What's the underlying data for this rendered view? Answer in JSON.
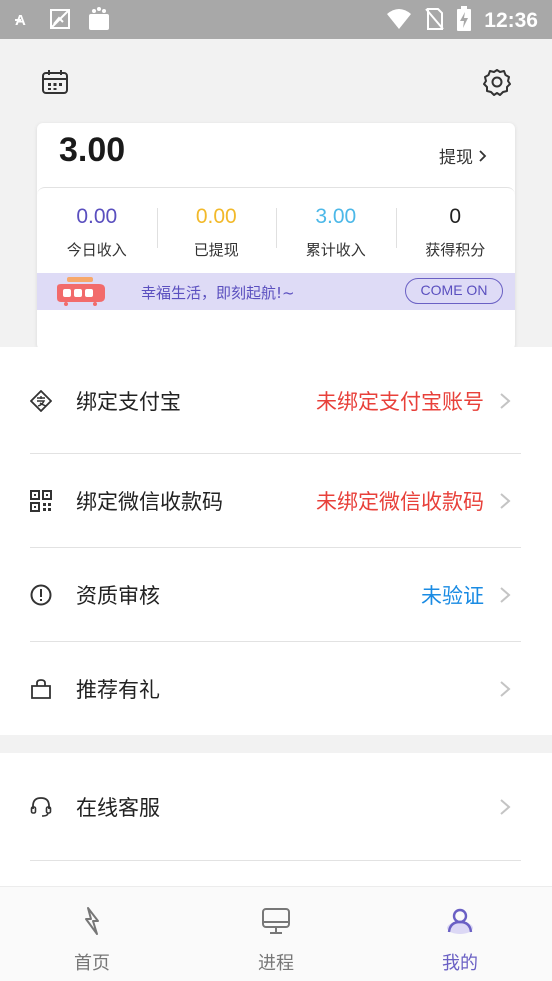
{
  "status_bar": {
    "time": "12:36",
    "icons": [
      "font-a-icon",
      "image-icon",
      "bag-icon",
      "wifi-icon",
      "no-sim-icon",
      "battery-charging-icon"
    ]
  },
  "header": {
    "left_icon": "calendar-icon",
    "right_icon": "settings-icon"
  },
  "card": {
    "balance": "3.00",
    "withdraw_label": "提现",
    "stats": [
      {
        "value": "0.00",
        "label": "今日收入",
        "color": "#5a4fbf"
      },
      {
        "value": "0.00",
        "label": "已提现",
        "color": "#f2b92a"
      },
      {
        "value": "3.00",
        "label": "累计收入",
        "color": "#4cb8e8"
      },
      {
        "value": "0",
        "label": "获得积分",
        "color": "#222222"
      }
    ],
    "banner": {
      "text": "幸福生活，即刻起航!~",
      "button": "COME ON",
      "icon": "rocket-icon"
    }
  },
  "menu": {
    "group1": [
      {
        "icon": "alipay-icon",
        "label": "绑定支付宝",
        "status": "未绑定支付宝账号",
        "status_color": "#e8403a"
      },
      {
        "icon": "qrcode-icon",
        "label": "绑定微信收款码",
        "status": "未绑定微信收款码",
        "status_color": "#e8403a"
      },
      {
        "icon": "alert-circle-icon",
        "label": "资质审核",
        "status": "未验证",
        "status_color": "#1a8be3"
      },
      {
        "icon": "shopping-bag-icon",
        "label": "推荐有礼",
        "status": ""
      }
    ],
    "group2": [
      {
        "icon": "headset-icon",
        "label": "在线客服",
        "status": ""
      }
    ]
  },
  "tabbar": {
    "tabs": [
      {
        "label": "首页",
        "icon": "lightning-icon",
        "active": false
      },
      {
        "label": "进程",
        "icon": "monitor-icon",
        "active": false
      },
      {
        "label": "我的",
        "icon": "user-icon",
        "active": true
      }
    ],
    "accent_color": "#6a60c4"
  }
}
